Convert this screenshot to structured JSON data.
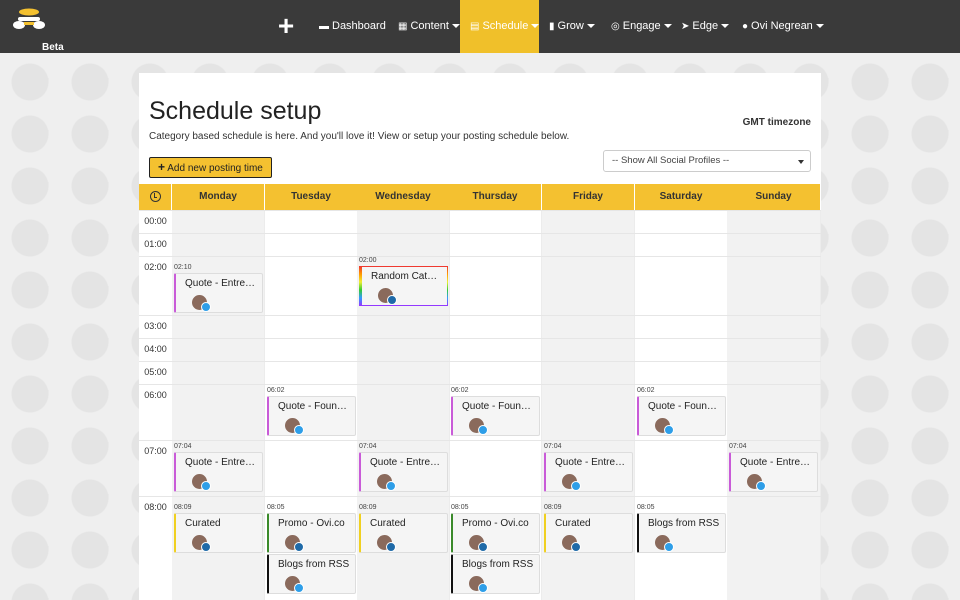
{
  "nav": {
    "beta": "Beta",
    "items": [
      {
        "label": "Dashboard",
        "icon": "briefcase-icon",
        "caret": false
      },
      {
        "label": "Content",
        "icon": "grid-icon",
        "caret": true
      },
      {
        "label": "Schedule",
        "icon": "calendar-icon",
        "caret": true,
        "active": true
      },
      {
        "label": "Grow",
        "icon": "chart-icon",
        "caret": true
      },
      {
        "label": "Engage",
        "icon": "target-icon",
        "caret": true
      },
      {
        "label": "Edge",
        "icon": "rocket-icon",
        "caret": true
      },
      {
        "label": "Ovi Negrean",
        "icon": "user-icon",
        "caret": true
      }
    ]
  },
  "page": {
    "title": "Schedule setup",
    "subtitle": "Category based schedule is here. And you'll love it! View or setup your posting schedule below.",
    "timezone": "GMT timezone",
    "add_button": "Add new posting time",
    "profile_select": "-- Show All Social Profiles --"
  },
  "days": [
    "Monday",
    "Tuesday",
    "Wednesday",
    "Thursday",
    "Friday",
    "Saturday",
    "Sunday"
  ],
  "hours": [
    "00:00",
    "01:00",
    "02:00",
    "03:00",
    "04:00",
    "05:00",
    "06:00",
    "07:00",
    "08:00"
  ],
  "colors": {
    "accent": "#f4c130",
    "nav": "#3a3a3a",
    "quote": "#c95bd8",
    "curated": "#f0d020",
    "promo": "#3a8a2a",
    "rss": "#111111"
  },
  "posts": [
    {
      "day": 0,
      "time": "02:10",
      "title": "Quote - Entre…",
      "network": "twitter",
      "color": "#c95bd8"
    },
    {
      "day": 2,
      "time": "02:00",
      "title": "Random Cat…",
      "network": "linkedin",
      "color": "rainbow"
    },
    {
      "day": 1,
      "time": "06:02",
      "title": "Quote - Foun…",
      "network": "twitter",
      "color": "#c95bd8"
    },
    {
      "day": 3,
      "time": "06:02",
      "title": "Quote - Foun…",
      "network": "twitter",
      "color": "#c95bd8"
    },
    {
      "day": 5,
      "time": "06:02",
      "title": "Quote - Foun…",
      "network": "twitter",
      "color": "#c95bd8"
    },
    {
      "day": 0,
      "time": "07:04",
      "title": "Quote - Entre…",
      "network": "twitter",
      "color": "#c95bd8"
    },
    {
      "day": 2,
      "time": "07:04",
      "title": "Quote - Entre…",
      "network": "twitter",
      "color": "#c95bd8"
    },
    {
      "day": 4,
      "time": "07:04",
      "title": "Quote - Entre…",
      "network": "twitter",
      "color": "#c95bd8"
    },
    {
      "day": 6,
      "time": "07:04",
      "title": "Quote - Entre…",
      "network": "twitter",
      "color": "#c95bd8"
    },
    {
      "day": 0,
      "time": "08:09",
      "title": "Curated",
      "network": "linkedin",
      "color": "#f0d020"
    },
    {
      "day": 1,
      "time": "08:05",
      "title": "Promo - Ovi.co",
      "network": "linkedin",
      "color": "#3a8a2a"
    },
    {
      "day": 1,
      "time": "",
      "title": "Blogs from RSS",
      "network": "twitter",
      "color": "#111111"
    },
    {
      "day": 2,
      "time": "08:09",
      "title": "Curated",
      "network": "linkedin",
      "color": "#f0d020"
    },
    {
      "day": 3,
      "time": "08:05",
      "title": "Promo - Ovi.co",
      "network": "linkedin",
      "color": "#3a8a2a"
    },
    {
      "day": 3,
      "time": "",
      "title": "Blogs from RSS",
      "network": "twitter",
      "color": "#111111"
    },
    {
      "day": 4,
      "time": "08:09",
      "title": "Curated",
      "network": "linkedin",
      "color": "#f0d020"
    },
    {
      "day": 5,
      "time": "08:05",
      "title": "Blogs from RSS",
      "network": "twitter",
      "color": "#111111"
    }
  ]
}
